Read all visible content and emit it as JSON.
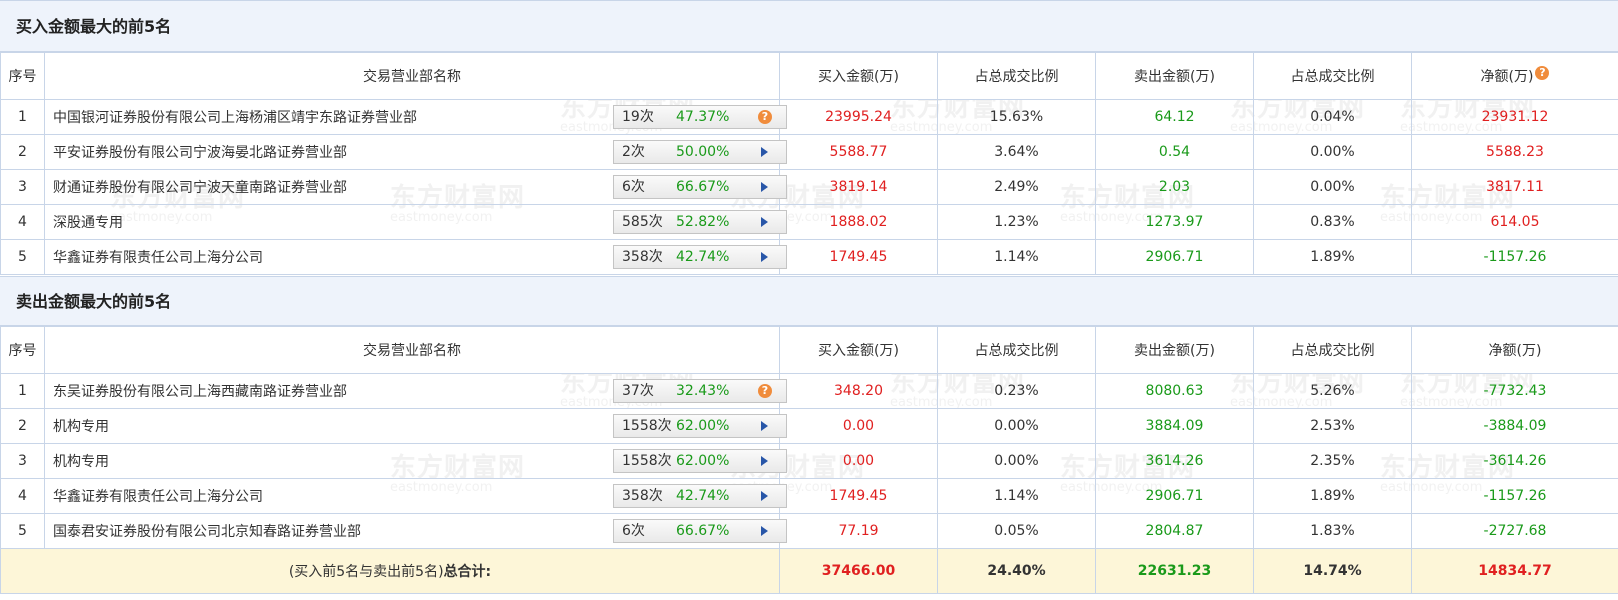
{
  "watermark": {
    "cn": "东方财富网",
    "en": "eastmoney.com"
  },
  "headers": {
    "index": "序号",
    "name": "交易营业部名称",
    "buy": "买入金额(万)",
    "buy_pct": "占总成交比例",
    "sell": "卖出金额(万)",
    "sell_pct": "占总成交比例",
    "net": "净额(万)",
    "help_icon": "?"
  },
  "buy_section": {
    "title": "买入金额最大的前5名",
    "rows": [
      {
        "index": "1",
        "name": "中国银河证券股份有限公司上海杨浦区靖宇东路证券营业部",
        "count": "19次",
        "rate": "47.37%",
        "icon": "help-icon",
        "buy": "23995.24",
        "buy_pct": "15.63%",
        "sell": "64.12",
        "sell_pct": "0.04%",
        "net": "23931.12"
      },
      {
        "index": "2",
        "name": "平安证券股份有限公司宁波海晏北路证券营业部",
        "count": "2次",
        "rate": "50.00%",
        "icon": "arrow-right-icon",
        "buy": "5588.77",
        "buy_pct": "3.64%",
        "sell": "0.54",
        "sell_pct": "0.00%",
        "net": "5588.23"
      },
      {
        "index": "3",
        "name": "财通证券股份有限公司宁波天童南路证券营业部",
        "count": "6次",
        "rate": "66.67%",
        "icon": "arrow-right-icon",
        "buy": "3819.14",
        "buy_pct": "2.49%",
        "sell": "2.03",
        "sell_pct": "0.00%",
        "net": "3817.11"
      },
      {
        "index": "4",
        "name": "深股通专用",
        "count": "585次",
        "rate": "52.82%",
        "icon": "arrow-right-icon",
        "buy": "1888.02",
        "buy_pct": "1.23%",
        "sell": "1273.97",
        "sell_pct": "0.83%",
        "net": "614.05"
      },
      {
        "index": "5",
        "name": "华鑫证券有限责任公司上海分公司",
        "count": "358次",
        "rate": "42.74%",
        "icon": "arrow-right-icon",
        "buy": "1749.45",
        "buy_pct": "1.14%",
        "sell": "2906.71",
        "sell_pct": "1.89%",
        "net": "-1157.26"
      }
    ]
  },
  "sell_section": {
    "title": "卖出金额最大的前5名",
    "rows": [
      {
        "index": "1",
        "name": "东吴证券股份有限公司上海西藏南路证券营业部",
        "count": "37次",
        "rate": "32.43%",
        "icon": "help-icon",
        "buy": "348.20",
        "buy_pct": "0.23%",
        "sell": "8080.63",
        "sell_pct": "5.26%",
        "net": "-7732.43"
      },
      {
        "index": "2",
        "name": "机构专用",
        "count": "1558次",
        "rate": "62.00%",
        "icon": "arrow-right-icon",
        "buy": "0.00",
        "buy_pct": "0.00%",
        "sell": "3884.09",
        "sell_pct": "2.53%",
        "net": "-3884.09"
      },
      {
        "index": "3",
        "name": "机构专用",
        "count": "1558次",
        "rate": "62.00%",
        "icon": "arrow-right-icon",
        "buy": "0.00",
        "buy_pct": "0.00%",
        "sell": "3614.26",
        "sell_pct": "2.35%",
        "net": "-3614.26"
      },
      {
        "index": "4",
        "name": "华鑫证券有限责任公司上海分公司",
        "count": "358次",
        "rate": "42.74%",
        "icon": "arrow-right-icon",
        "buy": "1749.45",
        "buy_pct": "1.14%",
        "sell": "2906.71",
        "sell_pct": "1.89%",
        "net": "-1157.26"
      },
      {
        "index": "5",
        "name": "国泰君安证券股份有限公司北京知春路证券营业部",
        "count": "6次",
        "rate": "66.67%",
        "icon": "arrow-right-icon",
        "buy": "77.19",
        "buy_pct": "0.05%",
        "sell": "2804.87",
        "sell_pct": "1.83%",
        "net": "-2727.68"
      }
    ]
  },
  "total": {
    "label_prefix": "(买入前5名与卖出前5名)",
    "label_bold": "总合计:",
    "buy": "37466.00",
    "buy_pct": "24.40%",
    "sell": "22631.23",
    "sell_pct": "14.74%",
    "net": "14834.77"
  },
  "colors": {
    "positive": "#e02020",
    "negative": "#1a9a1a",
    "rate": "#1a9a1a",
    "header_bg": "#eef3fb",
    "total_bg": "#fdf6d8"
  }
}
